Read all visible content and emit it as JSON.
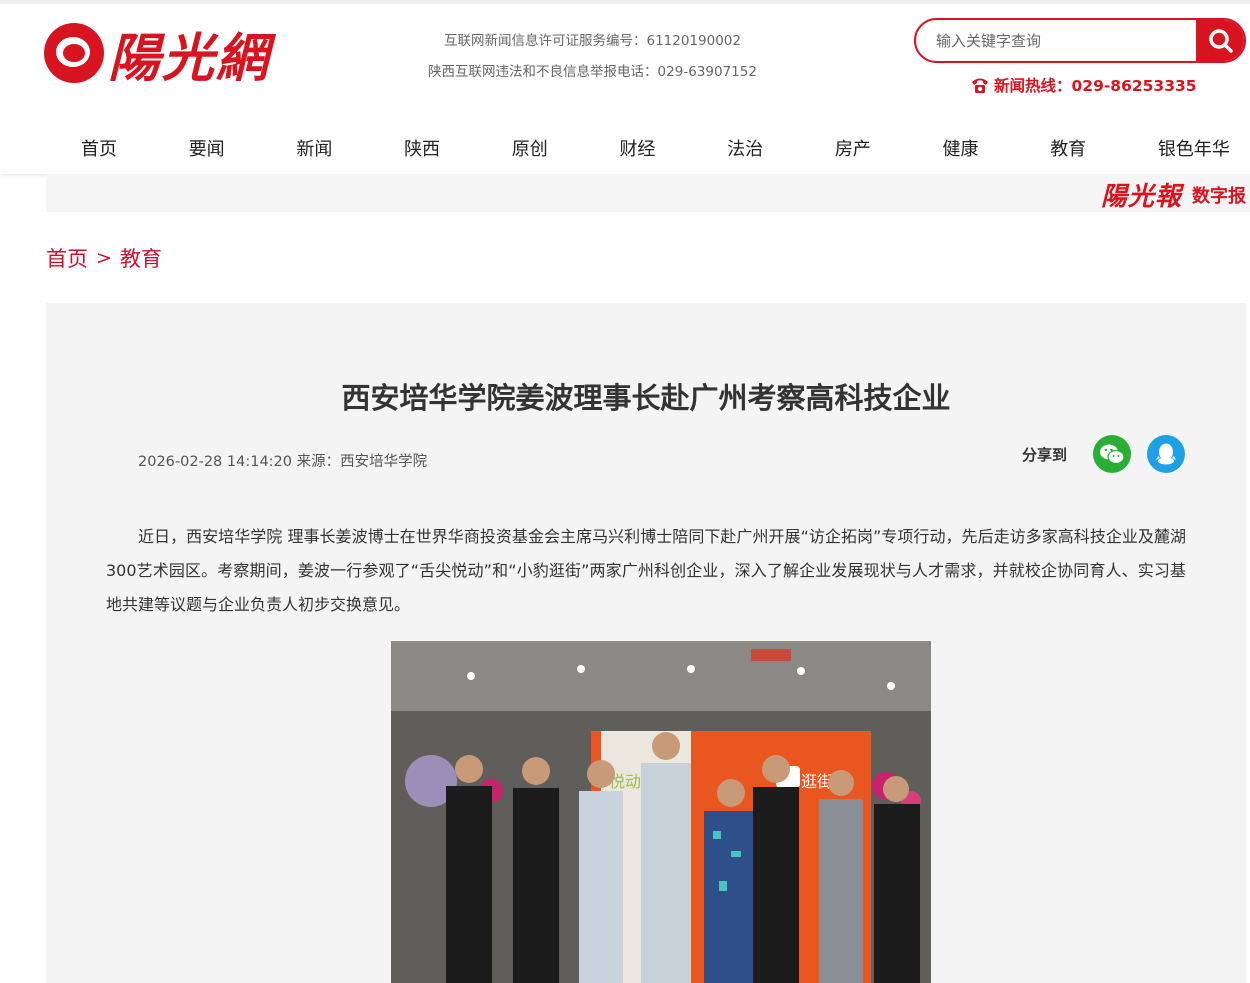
{
  "site": {
    "logo_text": "陽光網",
    "license_lines": [
      "互联网新闻信息许可证服务编号：61120190002",
      "陕西互联网违法和不良信息举报电话：029-63907152"
    ],
    "search_placeholder": "输入关键字查询",
    "hotline": "新闻热线：029-86253335"
  },
  "nav": {
    "items": [
      "首页",
      "要闻",
      "新闻",
      "陕西",
      "原创",
      "财经",
      "法治",
      "房产",
      "健康",
      "教育",
      "银色年华"
    ]
  },
  "digital": {
    "logo_text": "陽光報",
    "label": "数字报"
  },
  "breadcrumb": {
    "home": "首页",
    "separator": ">",
    "current": "教育"
  },
  "article": {
    "title": "西安培华学院姜波理事长赴广州考察高科技企业",
    "meta": "2026-02-28 14:14:20 来源：西安培华学院",
    "share_label": "分享到",
    "paragraph": "近日，西安培华学院 理事长姜波博士在世界华商投资基金会主席马兴利博士陪同下赴广州开展“访企拓岗”专项行动，先后走访多家高科技企业及麓湖300艺术园区。考察期间，姜波一行参观了“舌尖悦动”和“小豹逛街”两家广州科创企业，深入了解企业发展现状与人才需求，并就校企协同育人、实习基地共建等议题与企业负责人初步交换意见。",
    "photo_sign_left": "悦动",
    "photo_sign_right": "逛街"
  },
  "colors": {
    "brand_red": "#d7141f",
    "breadcrumb_red": "#c8102e",
    "wechat_green": "#2aae37",
    "qq_blue": "#1ea0e6"
  }
}
